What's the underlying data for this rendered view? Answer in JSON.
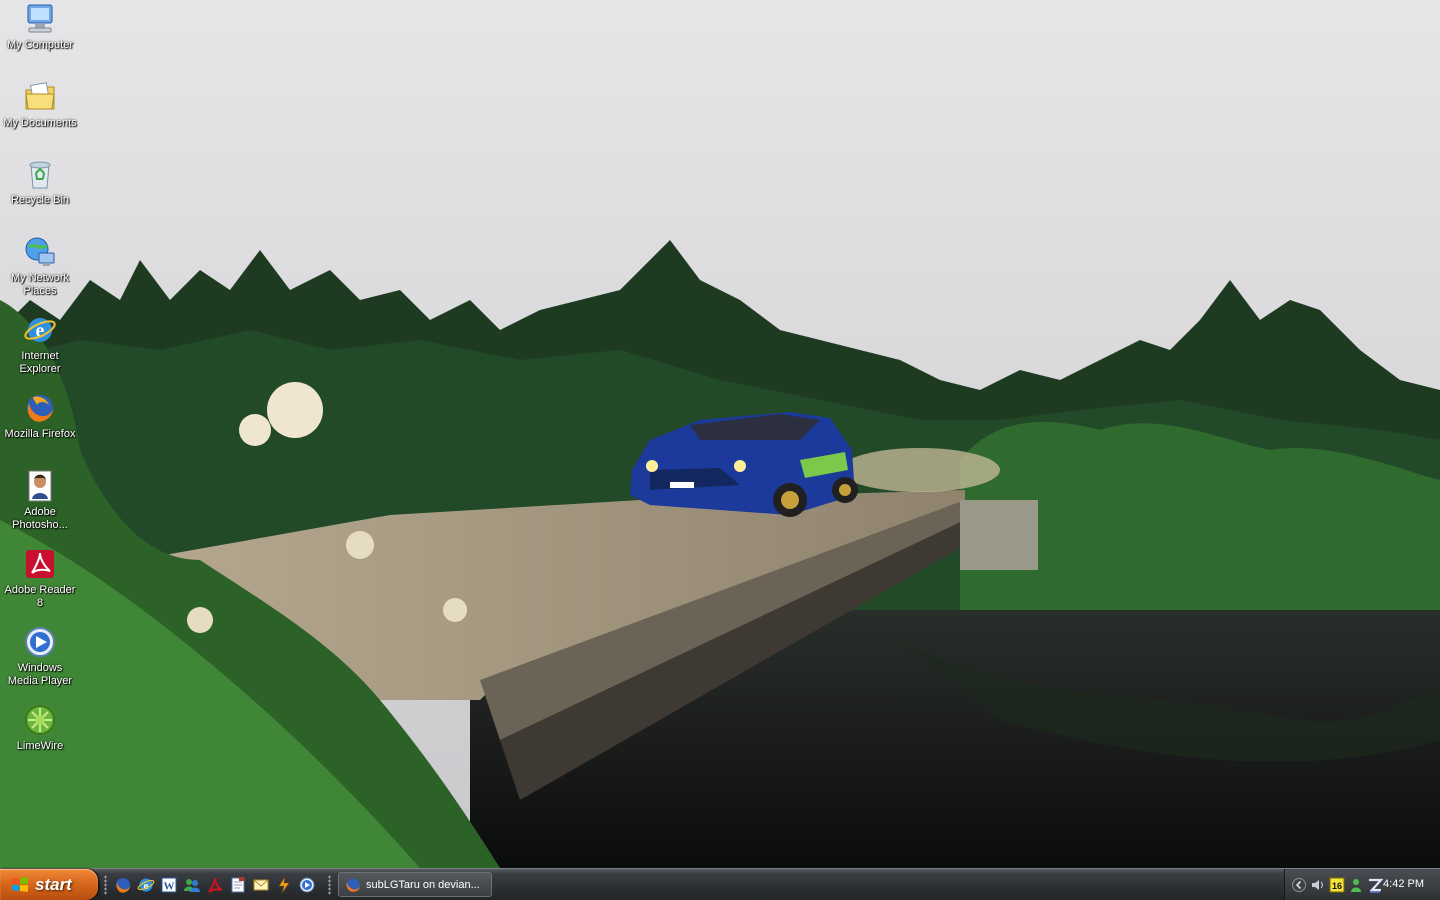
{
  "desktop": {
    "icons": [
      {
        "label": "My Computer",
        "icon": "my-computer-icon"
      },
      {
        "label": "My Documents",
        "icon": "my-documents-icon"
      },
      {
        "label": "Recycle Bin",
        "icon": "recycle-bin-icon"
      },
      {
        "label": "My Network Places",
        "icon": "network-places-icon"
      },
      {
        "label": "Internet Explorer",
        "icon": "internet-explorer-icon"
      },
      {
        "label": "Mozilla Firefox",
        "icon": "firefox-icon"
      },
      {
        "label": "Adobe Photosho...",
        "icon": "photoshop-icon"
      },
      {
        "label": "Adobe Reader 8",
        "icon": "adobe-reader-icon"
      },
      {
        "label": "Windows Media Player",
        "icon": "media-player-icon"
      },
      {
        "label": "LimeWire",
        "icon": "limewire-icon"
      }
    ]
  },
  "taskbar": {
    "start_label": "start",
    "quick_launch": [
      "firefox-icon",
      "internet-explorer-icon",
      "word-icon",
      "messenger-icon",
      "adobe-reader-icon",
      "notepad-icon",
      "outlook-icon",
      "winamp-icon",
      "media-player-icon"
    ],
    "task": {
      "label": "subLGTaru on devian...",
      "icon": "firefox-icon"
    },
    "tray": {
      "badge": "16",
      "icons": [
        "chevron-left-icon",
        "speaker-icon",
        "calendar-icon",
        "messenger-icon",
        "zone-alarm-icon"
      ],
      "clock": "4:42 PM"
    }
  },
  "colors": {
    "start_orange": "#d8681c",
    "taskbar_dark": "#2c2f33",
    "sky": "#d9d9dc",
    "forest": "#1d3d22",
    "water": "#121414",
    "car_blue": "#1b3a9c"
  }
}
